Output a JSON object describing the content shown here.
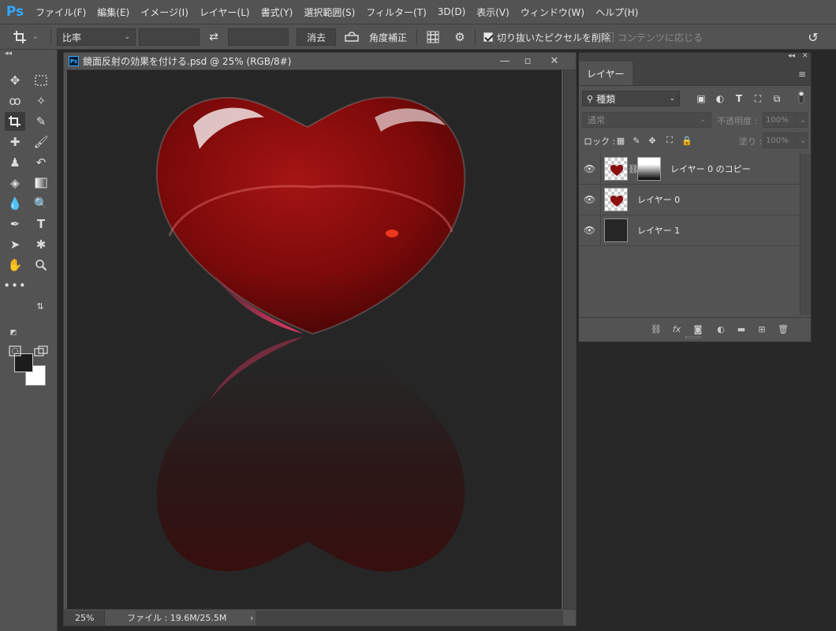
{
  "app": {
    "logo": "Ps",
    "menu": [
      "ファイル(F)",
      "編集(E)",
      "イメージ(I)",
      "レイヤー(L)",
      "書式(Y)",
      "選択範囲(S)",
      "フィルター(T)",
      "3D(D)",
      "表示(V)",
      "ウィンドウ(W)",
      "ヘルプ(H)"
    ]
  },
  "options": {
    "tool_icon": "crop-tool-icon",
    "ratio_select": "比率",
    "swap_icon": "⇄",
    "clear_button": "消去",
    "straighten_label": "角度補正",
    "delete_cropped_label": "切り抜いたピクセルを削除",
    "delete_cropped_checked": true,
    "content_aware_label": "コンテンツに応じる",
    "content_aware_checked": false
  },
  "toolbar": {
    "collapse": "◂◂"
  },
  "document": {
    "icon": "Ps",
    "title": "鏡面反射の効果を付ける.psd @ 25% (RGB/8#)",
    "zoom": "25%",
    "file_info": "ファイル : 19.6M/25.5M",
    "status_arrow": "›",
    "heart_color": "#7d0a0a",
    "background_color": "#262626"
  },
  "layers_panel": {
    "collapse": "◂◂",
    "close": "✕",
    "tab": "レイヤー",
    "kind_select": "種類",
    "blend_mode": "通常",
    "opacity_label": "不透明度 :",
    "opacity_value": "100%",
    "lock_label": "ロック :",
    "fill_label": "塗り :",
    "fill_value": "100%",
    "layers": [
      {
        "name": "レイヤー 0 のコピー",
        "visible": true,
        "has_mask": true,
        "thumb": "heart"
      },
      {
        "name": "レイヤー 0",
        "visible": true,
        "has_mask": false,
        "thumb": "heart"
      },
      {
        "name": "レイヤー 1",
        "visible": true,
        "has_mask": false,
        "thumb": "dark"
      }
    ]
  }
}
